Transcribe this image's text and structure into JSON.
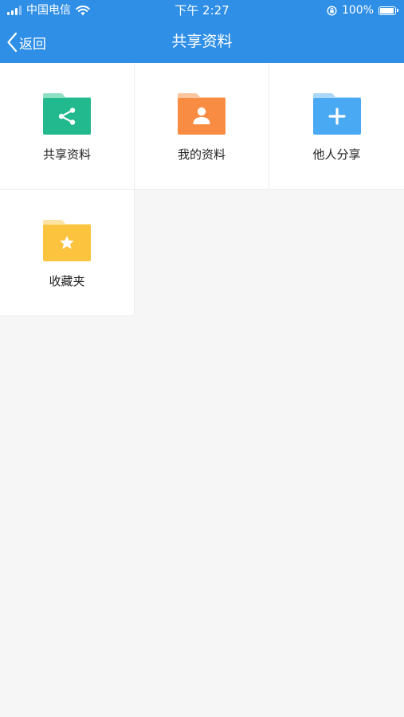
{
  "status_bar": {
    "carrier": "中国电信",
    "time": "下午 2:27",
    "battery": "100%",
    "battery_level": 1.0
  },
  "nav": {
    "back_label": "返回",
    "title": "共享资料"
  },
  "tiles": [
    {
      "label": "共享资料",
      "icon": "share-folder-icon",
      "color": "#21b98d",
      "tab_color": "#8fe0c2"
    },
    {
      "label": "我的资料",
      "icon": "person-folder-icon",
      "color": "#f98c43",
      "tab_color": "#fcc59e"
    },
    {
      "label": "他人分享",
      "icon": "plus-folder-icon",
      "color": "#4aa9f3",
      "tab_color": "#a9d6f9"
    },
    {
      "label": "收藏夹",
      "icon": "star-folder-icon",
      "color": "#fcc33f",
      "tab_color": "#fde3a3"
    }
  ],
  "colors": {
    "header": "#2f8fe6",
    "background": "#f6f6f6"
  }
}
